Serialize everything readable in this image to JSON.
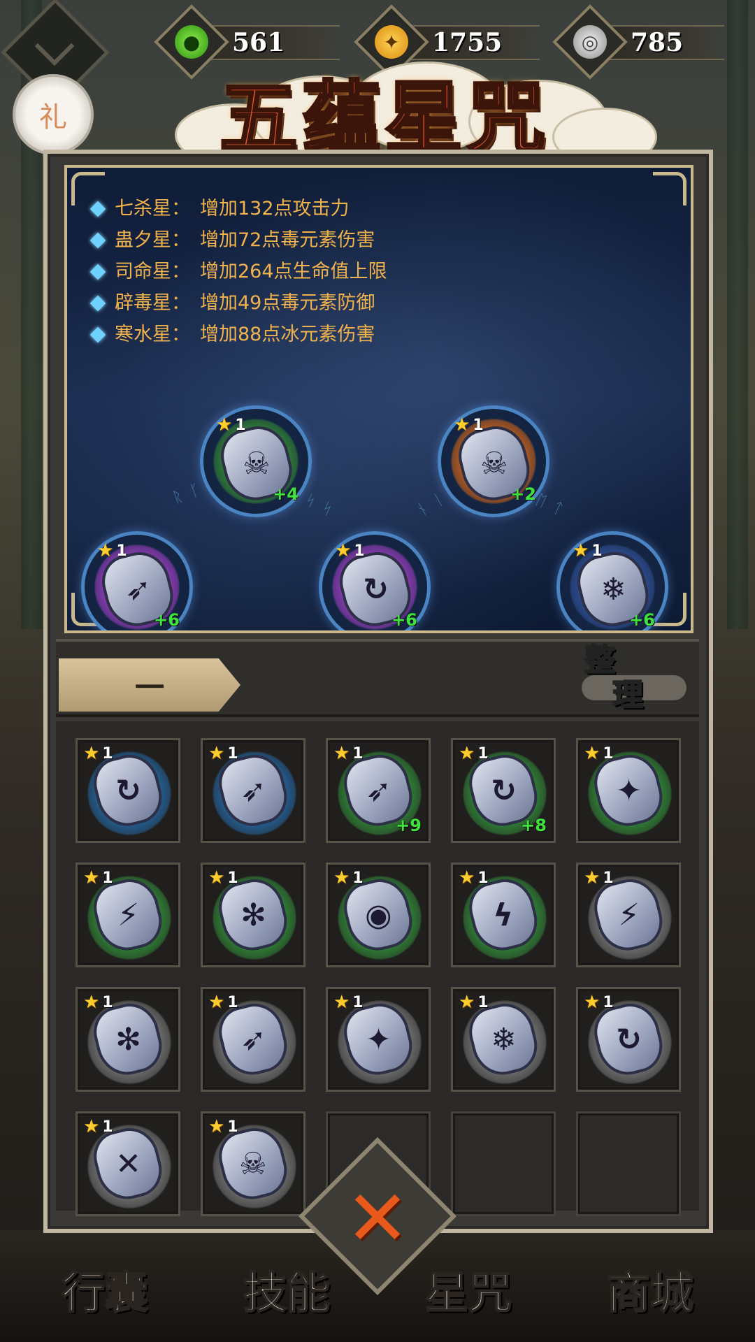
{
  "resources": [
    {
      "name": "jade",
      "icon": "green-flame-icon",
      "color": "#4fd11e",
      "value": "561"
    },
    {
      "name": "gold",
      "icon": "gold-coin-icon",
      "color": "#f2a516",
      "value": "1755"
    },
    {
      "name": "silver",
      "icon": "silver-swirl-icon",
      "color": "#bfbfbf",
      "value": "785"
    }
  ],
  "gift_label": "礼",
  "title": "五蕴星咒",
  "effects": [
    {
      "name": "七杀星",
      "sep": "：",
      "text": "增加132点攻击力"
    },
    {
      "name": "蛊夕星",
      "sep": "：",
      "text": "增加72点毒元素伤害"
    },
    {
      "name": "司命星",
      "sep": "：",
      "text": "增加264点生命值上限"
    },
    {
      "name": "辟毒星",
      "sep": "：",
      "text": "增加49点毒元素防御"
    },
    {
      "name": "寒水星",
      "sep": "：",
      "text": "增加88点冰元素伤害"
    }
  ],
  "equipped": [
    {
      "star": "1",
      "plus": "+6",
      "glyph": "➶",
      "aura": "#8a3bb0"
    },
    {
      "star": "1",
      "plus": "+4",
      "glyph": "☠",
      "aura": "#2f7a35"
    },
    {
      "star": "1",
      "plus": "+6",
      "glyph": "↻",
      "aura": "#8a3bb0"
    },
    {
      "star": "1",
      "plus": "+2",
      "glyph": "☠",
      "aura": "#b35a1e"
    },
    {
      "star": "1",
      "plus": "+6",
      "glyph": "❄",
      "aura": "#2c4b8c"
    }
  ],
  "tab_label": "一",
  "sort_label": [
    "整",
    "理"
  ],
  "inventory": [
    {
      "star": "1",
      "plus": "",
      "glyph": "↻",
      "aura": "#245c8e"
    },
    {
      "star": "1",
      "plus": "",
      "glyph": "➶",
      "aura": "#245c8e"
    },
    {
      "star": "1",
      "plus": "+9",
      "glyph": "➶",
      "aura": "#2f7a35"
    },
    {
      "star": "1",
      "plus": "+8",
      "glyph": "↻",
      "aura": "#2f7a35"
    },
    {
      "star": "1",
      "plus": "",
      "glyph": "✦",
      "aura": "#2f7a35"
    },
    {
      "star": "1",
      "plus": "",
      "glyph": "⚡",
      "aura": "#2f7a35"
    },
    {
      "star": "1",
      "plus": "",
      "glyph": "✻",
      "aura": "#2f7a35"
    },
    {
      "star": "1",
      "plus": "",
      "glyph": "◉",
      "aura": "#2f7a35"
    },
    {
      "star": "1",
      "plus": "",
      "glyph": "ϟ",
      "aura": "#2f7a35"
    },
    {
      "star": "1",
      "plus": "",
      "glyph": "⚡",
      "aura": "#6a6a6a"
    },
    {
      "star": "1",
      "plus": "",
      "glyph": "✻",
      "aura": "#6a6a6a"
    },
    {
      "star": "1",
      "plus": "",
      "glyph": "➶",
      "aura": "#6a6a6a"
    },
    {
      "star": "1",
      "plus": "",
      "glyph": "✦",
      "aura": "#6a6a6a"
    },
    {
      "star": "1",
      "plus": "",
      "glyph": "❄",
      "aura": "#6a6a6a"
    },
    {
      "star": "1",
      "plus": "",
      "glyph": "↻",
      "aura": "#6a6a6a"
    },
    {
      "star": "1",
      "plus": "",
      "glyph": "✕",
      "aura": "#6a6a6a"
    },
    {
      "star": "1",
      "plus": "",
      "glyph": "☠",
      "aura": "#6a6a6a"
    }
  ],
  "close_label": "✕",
  "nav": [
    "行囊",
    "技能",
    "星咒",
    "商城"
  ]
}
